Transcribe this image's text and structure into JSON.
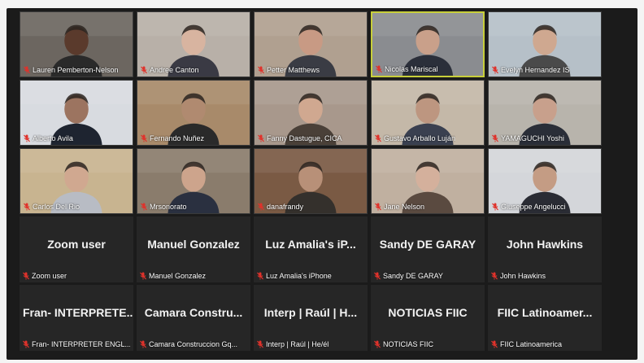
{
  "tiles": [
    {
      "name": "Lauren Pemberton-Nelson",
      "skin": "#5a3a2c",
      "bg": "#6c6660",
      "shirt": "#2a2a2a"
    },
    {
      "name": "Andree Canton",
      "skin": "#d8b4a0",
      "bg": "#b8b0a8",
      "shirt": "#3a3a44"
    },
    {
      "name": "Petter Matthews",
      "skin": "#c89a84",
      "bg": "#b0a090",
      "shirt": "#3a3c44"
    },
    {
      "name": "Nicolas Mariscal",
      "skin": "#c9a08a",
      "bg": "#8a8c90",
      "shirt": "#2b2f3a",
      "active": true
    },
    {
      "name": "Evelyn Hernandez IS",
      "skin": "#cfa890",
      "bg": "#b6c0c8",
      "shirt": "#4a4a4a"
    },
    {
      "name": "Alberto Avila",
      "skin": "#9c7460",
      "bg": "#d8dbe0",
      "shirt": "#1e2430"
    },
    {
      "name": "Fernando Nuñez",
      "skin": "#b08a70",
      "bg": "#a88a6a",
      "shirt": "#2a2a2a"
    },
    {
      "name": "Fanny Dastugue, CICA",
      "skin": "#d0a890",
      "bg": "#a8988c",
      "shirt": "#4a4038"
    },
    {
      "name": "Gustavo Arballo Luján",
      "skin": "#bd9680",
      "bg": "#c4b8a8",
      "shirt": "#3a4050"
    },
    {
      "name": "YAMAGUCHI Yoshi",
      "skin": "#c8a08c",
      "bg": "#b8b4ac",
      "shirt": "#2a2e38"
    },
    {
      "name": "Carlos Del Rio",
      "skin": "#d0a890",
      "bg": "#c8b490",
      "shirt": "#b8bcc4"
    },
    {
      "name": "Mrsonorato",
      "skin": "#cda48c",
      "bg": "#8a7c6c",
      "shirt": "#2a3040"
    },
    {
      "name": "danafrandy",
      "skin": "#b89078",
      "bg": "#7a5a44",
      "shirt": "#34302c"
    },
    {
      "name": "Jane Nelson",
      "skin": "#d4b09c",
      "bg": "#c0b0a0",
      "shirt": "#5a4a40"
    },
    {
      "name": "Giuseppe Angelucci",
      "skin": "#c49c84",
      "bg": "#d4d6da",
      "shirt": "#2a2c34"
    }
  ],
  "audio_only": [
    {
      "display": "Zoom user",
      "label": "Zoom user"
    },
    {
      "display": "Manuel Gonzalez",
      "label": "Manuel Gonzalez"
    },
    {
      "display": "Luz Amalia's iP...",
      "label": "Luz Amalia's iPhone"
    },
    {
      "display": "Sandy DE GARAY",
      "label": "Sandy DE GARAY"
    },
    {
      "display": "John Hawkins",
      "label": "John Hawkins"
    },
    {
      "display": "Fran-  INTERPRETE...",
      "label": "Fran- INTERPRETER ENGL..."
    },
    {
      "display": "Camara  Constru...",
      "label": "Camara Construccion Gq..."
    },
    {
      "display": "Interp | Raúl | H...",
      "label": "Interp | Raúl | He/él"
    },
    {
      "display": "NOTICIAS FIIC",
      "label": "NOTICIAS FIIC"
    },
    {
      "display": "FIIC  Latinoamer...",
      "label": "FIIC Latinoamerica"
    }
  ],
  "colors": {
    "frame": "#1b1b1b",
    "active_border": "#c8cf3a",
    "mic_muted": "#e0322b"
  },
  "icons": {
    "mic": "muted-mic-icon"
  }
}
